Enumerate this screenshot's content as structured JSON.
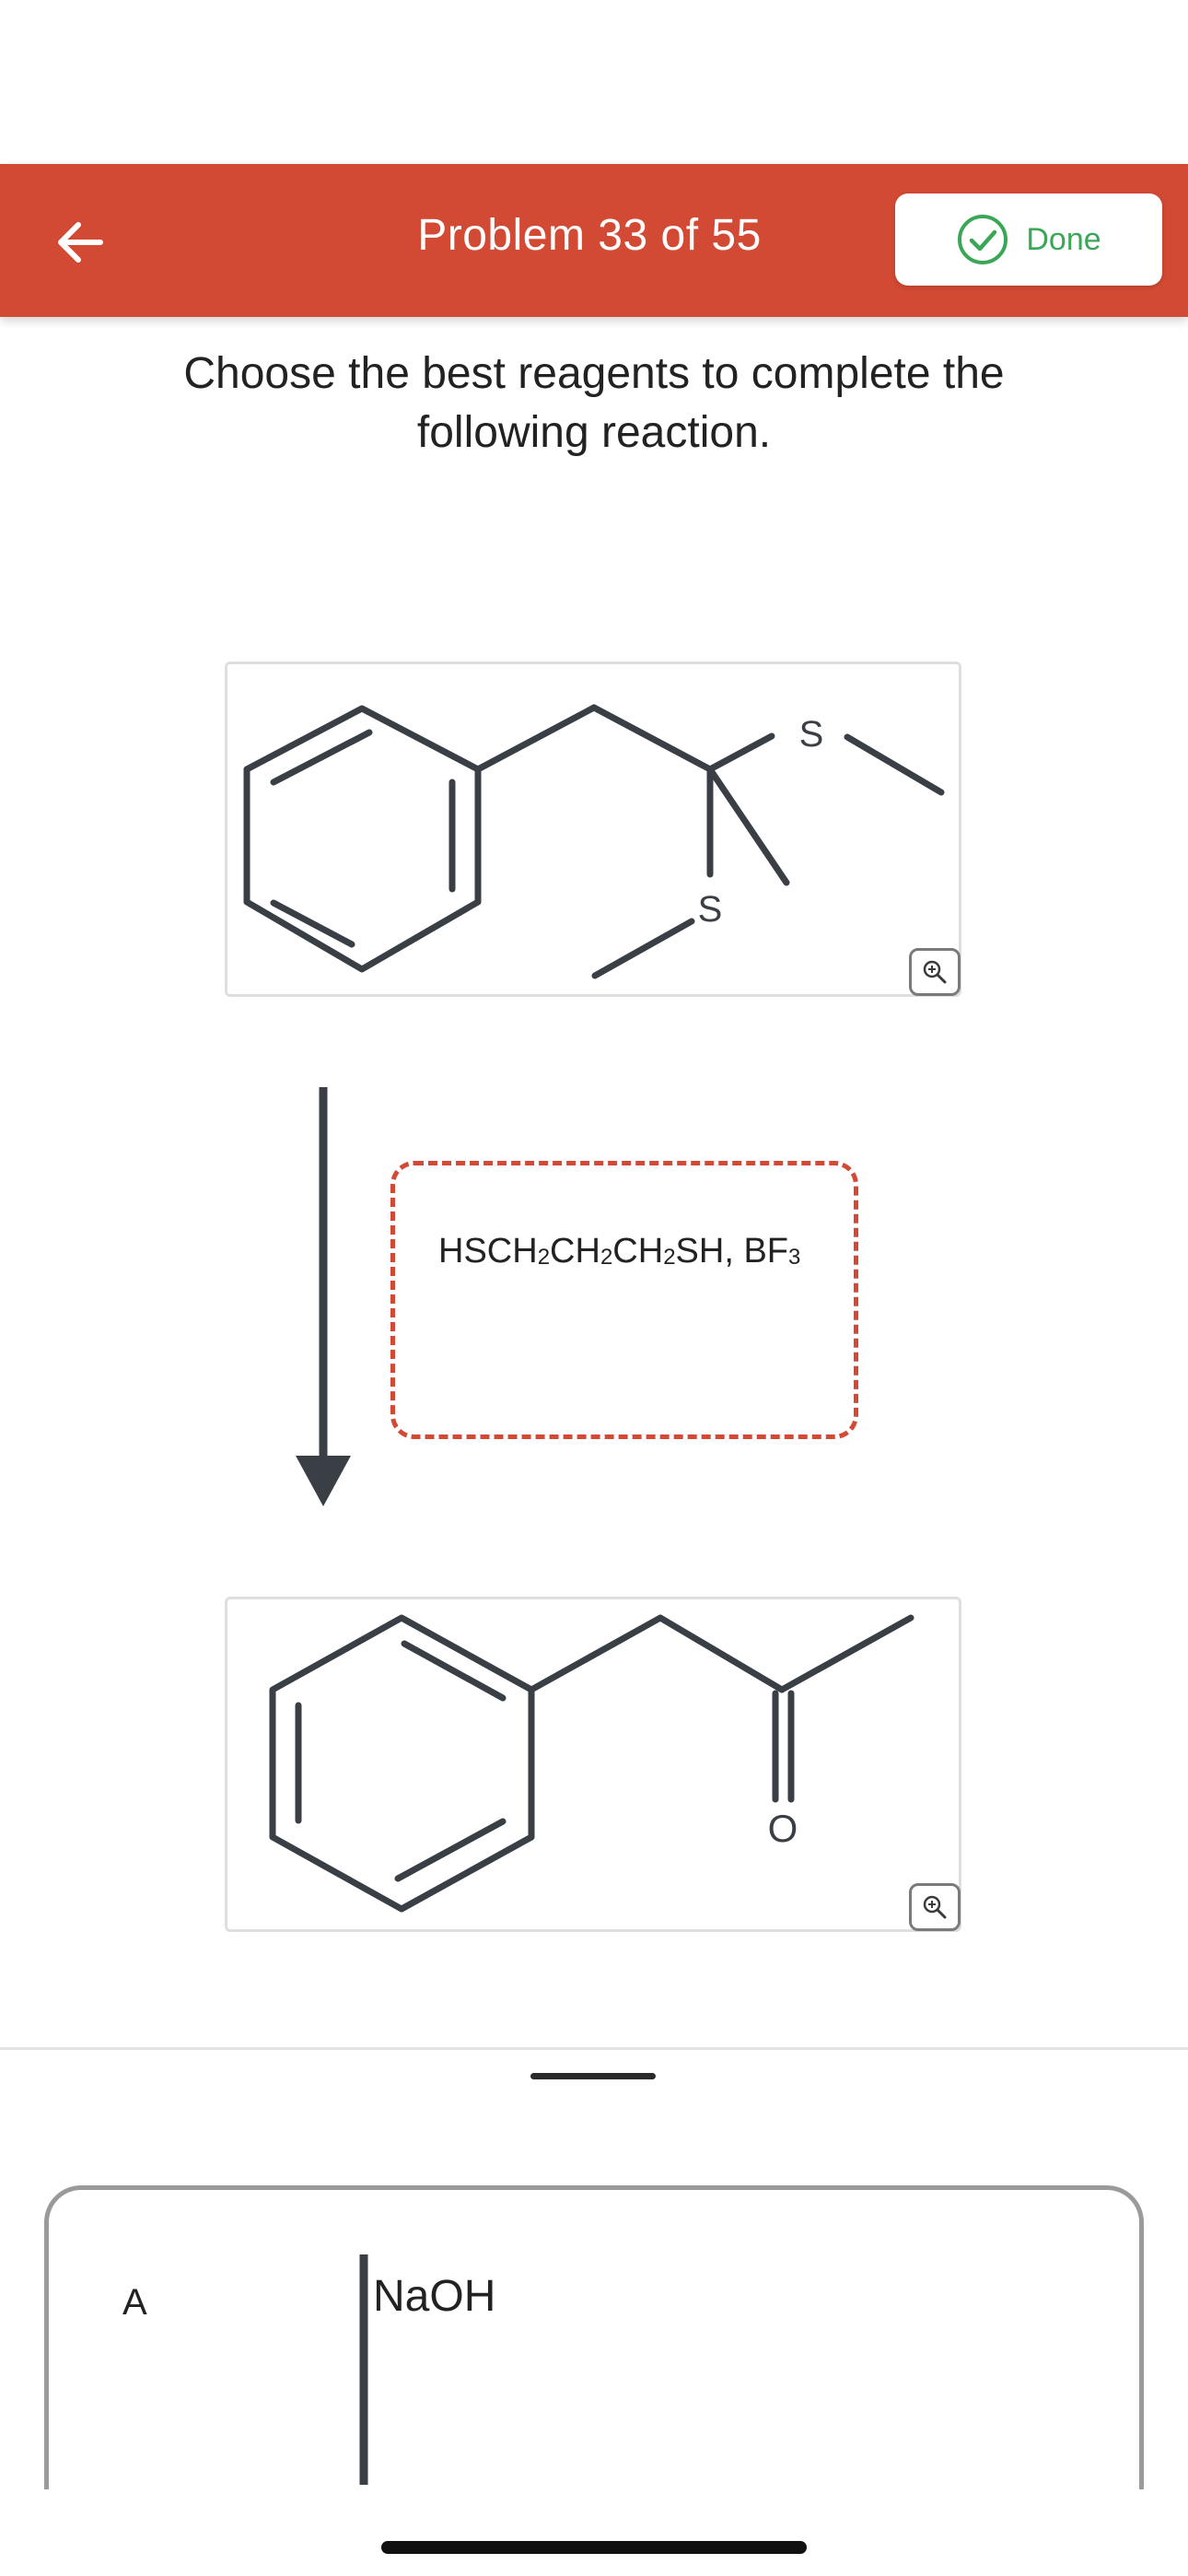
{
  "header": {
    "title": "Problem 33 of 55",
    "done_label": "Done",
    "back_icon": "arrow-left-icon",
    "done_icon": "check-circle-icon",
    "accent_color": "#d34a34",
    "done_color": "#3aa757"
  },
  "prompt": {
    "line1": "Choose the best reagents to complete the",
    "line2": "following reaction."
  },
  "reactant": {
    "atom_labels": [
      "S",
      "S"
    ],
    "zoom_icon": "zoom-in-icon"
  },
  "reagent_slot": {
    "parts": [
      "HSCH",
      "2",
      "CH",
      "2",
      "CH",
      "2",
      "SH, BF",
      "3"
    ]
  },
  "product": {
    "atom_labels": [
      "O"
    ],
    "zoom_icon": "zoom-in-icon"
  },
  "options": [
    {
      "letter": "A",
      "reagent": "NaOH"
    }
  ]
}
